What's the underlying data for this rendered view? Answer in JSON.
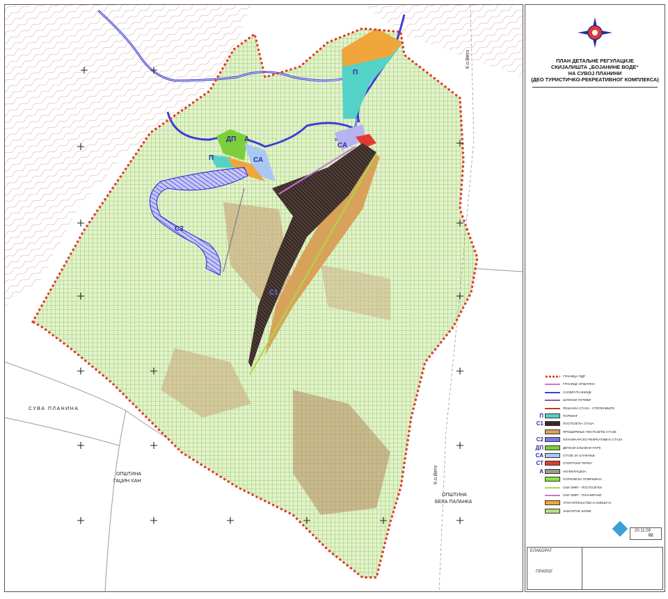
{
  "title": {
    "line1": "ПЛАН ДЕТАЉНЕ РЕГУЛАЦИЈЕ",
    "line2": "СКИЈАЛИШТА „БОЈАНИНЕ ВОДЕ“",
    "line3": "НА СУВОЈ ПЛАНИНИ",
    "line4": "(ДЕО ТУРИСТИЧКО-РЕКРЕАТИВНОГ КОМПЛЕКСА)"
  },
  "map_labels": {
    "k_o_veto_top": "К.о.Вето",
    "k_o_veto_bottom": "К.о.Вето",
    "suva_planina": "СУВА ПЛАНИНА",
    "opstina_gadzin_han_1": "ОПШТИНА",
    "opstina_gadzin_han_2": "ГАЏИН ХАН",
    "opstina_bela_palanka_1": "ОПШТИНА",
    "opstina_bela_palanka_2": "БЕЛА ПАЛАНКА"
  },
  "zones": {
    "p_top": "П",
    "dp": "ДП",
    "a": "А",
    "p_left": "П",
    "sa_left": "СА",
    "sa_right": "СА",
    "st": "СТ",
    "s2": "С2",
    "s1": "С1"
  },
  "legend": [
    {
      "code": "",
      "kind": "dots",
      "color": "#e23a2f",
      "label": "ГРАНИЦА ПДР"
    },
    {
      "code": "",
      "kind": "line",
      "color": "#c774d6",
      "label": "ГРАНИЦЕ ОПШТИНА"
    },
    {
      "code": "",
      "kind": "line",
      "color": "#3d3dd6",
      "label": "САОБРАЋАЈНИЦЕ"
    },
    {
      "code": "",
      "kind": "line",
      "color": "#8a5aa0",
      "label": "ШУМСКИ ПУТЕВИ"
    },
    {
      "code": "",
      "kind": "line",
      "color": "#c0392b",
      "label": "ПЕШАЧКА СТАЗА - СТЕПЕНИШТЕ"
    },
    {
      "code": "П",
      "kind": "box",
      "color": "#53d2c8",
      "label": "ПАРКИНГ"
    },
    {
      "code": "С1",
      "kind": "box",
      "color": "#3a2a26",
      "label": "ПОСТОЈЕЋА СТАЗА"
    },
    {
      "code": "",
      "kind": "box",
      "color": "#d9a25a",
      "label": "ПРОШИРЕЊЕ ПОСТОЈЕЋЕ СТАЗЕ"
    },
    {
      "code": "С2",
      "kind": "box",
      "color": "#7b7be8",
      "label": "ПЛАНИНАРСКО-РЕКРЕАТИВНА СТАЗА"
    },
    {
      "code": "ДП",
      "kind": "box",
      "color": "#7ccf3a",
      "label": "ДЕЧИЈИ ЗАБАВНИ ПАРК"
    },
    {
      "code": "СА",
      "kind": "box",
      "color": "#a9c8f2",
      "label": "СТАЗЕ ЗА САНКАЊЕ"
    },
    {
      "code": "СТ",
      "kind": "box",
      "color": "#e23a2f",
      "label": "СПОРТСКИ ТЕРЕН"
    },
    {
      "code": "А",
      "kind": "box",
      "color": "#9a9a9a",
      "label": "АКУМУЛАЦИЈА"
    },
    {
      "code": "",
      "kind": "box",
      "color": "#8ee04a",
      "label": "ПАРКОВСКА ПОВРШИНА"
    },
    {
      "code": "",
      "kind": "line",
      "color": "#a8d84a",
      "label": "СКИ ЛИФТ - ПОСТОЈЕЋИ"
    },
    {
      "code": "",
      "kind": "line",
      "color": "#c774d6",
      "label": "СКИ ЛИФТ - ПЛАНИРАНИ"
    },
    {
      "code": "",
      "kind": "box",
      "color": "#f0a63a",
      "label": "УГОСТИТЕЉСТВО И СМЕШТАЈ"
    },
    {
      "code": "",
      "kind": "box",
      "color": "#b9e07a",
      "label": "ЗАШТИТНЕ ШУМЕ"
    }
  ],
  "title_block": {
    "elaborat": "ЕЛАБОРАТ",
    "prilog": "ПРИЛОГ",
    "date": "20.11.09",
    "sheet_no": "02"
  },
  "colors": {
    "boundary": "#e23a2f",
    "hatch_green": "#7ccf3a",
    "area_fill": "#e4f0cf",
    "contour": "#b33a3a",
    "road": "#3d3dd6",
    "ski_run": "#3a2a26",
    "extension": "#d9a25a"
  }
}
